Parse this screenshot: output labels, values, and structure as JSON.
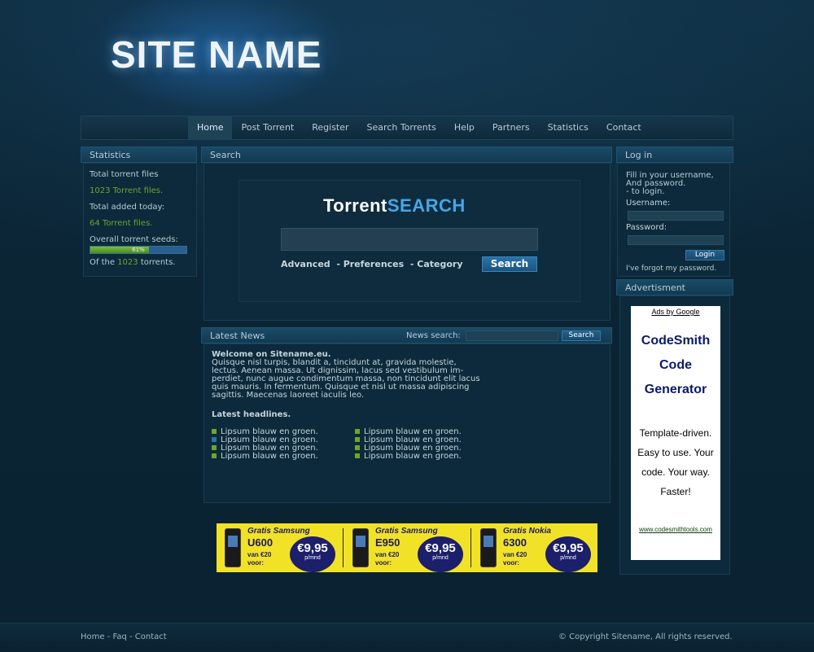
{
  "header": {
    "site_name": "SITE NAME"
  },
  "nav": {
    "items": [
      {
        "label": "Home"
      },
      {
        "label": "Post Torrent"
      },
      {
        "label": "Register"
      },
      {
        "label": "Search Torrents"
      },
      {
        "label": "Help"
      },
      {
        "label": "Partners"
      },
      {
        "label": "Statistics"
      },
      {
        "label": "Contact"
      }
    ],
    "active_index": 0
  },
  "statistics": {
    "title": "Statistics",
    "total_files_label": "Total torrent files",
    "total_files_value": "1023 Torrent files.",
    "added_today_label": "Total added today:",
    "added_today_value": "64 Torrent files.",
    "seeds_label": "Overall torrent seeds:",
    "seeds_percent": 61,
    "seeds_percent_label": "61%",
    "of_prefix": "Of the",
    "of_count": "1023",
    "of_suffix": "torrents."
  },
  "search": {
    "title": "Search",
    "logo_part1": "Torrent",
    "logo_part2": "SEARCH",
    "input_value": "",
    "link_advanced": "Advanced",
    "link_preferences": "- Preferences",
    "link_category": "- Category",
    "button_label": "Search"
  },
  "news": {
    "title": "Latest News",
    "search_label": "News search:",
    "search_value": "",
    "search_button": "Search",
    "welcome_heading": "Welcome on Sitename.eu.",
    "body_lines": [
      "Quisque nisl turpis, blandit a, tincidunt at, gravida molestie,",
      "lectus. Aenean massa. Ut dignissim, lacus sed vestibulum im-",
      "perdiet, nunc augue condimentum massa, non tincidunt elit lacus",
      "quis mauris. In fermentum. Quisque et nisl ut massa adipiscing",
      "sagittis. Maecenas laoreet iaculis leo."
    ],
    "headlines_title": "Latest headlines.",
    "headlines_left": [
      "Lipsum blauw en groen.",
      "Lipsum blauw en groen.",
      "Lipsum blauw en groen.",
      "Lipsum blauw en groen."
    ],
    "headlines_right": [
      "Lipsum blauw en groen.",
      "Lipsum blauw en groen.",
      "Lipsum blauw en groen.",
      "Lipsum blauw en groen."
    ]
  },
  "login": {
    "title": "Log in",
    "intro_lines": [
      "Fill in your username,",
      "And password.",
      "- to login."
    ],
    "username_label": "Username:",
    "username_value": "",
    "password_label": "Password:",
    "password_value": "",
    "button_label": "Login",
    "forgot_link": "I've forgot my password."
  },
  "advertisment": {
    "title": "Advertisment",
    "ads_by": "Ads by Google",
    "ad_title_lines": [
      "CodeSmith",
      "Code",
      "Generator"
    ],
    "ad_body_lines": [
      "Template-driven.",
      "Easy to use.  Your",
      "code.  Your way.",
      "Faster!"
    ],
    "ad_url": "www.codesmithtools.com"
  },
  "banner": {
    "offers": [
      {
        "title": "Gratis Samsung",
        "model": "U600",
        "from_line1": "van €20",
        "from_line2": "voor:",
        "price": "€9,95",
        "per": "p/mnd"
      },
      {
        "title": "Gratis Samsung",
        "model": "E950",
        "from_line1": "van €20",
        "from_line2": "voor:",
        "price": "€9,95",
        "per": "p/mnd"
      },
      {
        "title": "Gratis Nokia",
        "model": "6300",
        "from_line1": "van €20",
        "from_line2": "voor:",
        "price": "€9,95",
        "per": "p/mnd"
      }
    ]
  },
  "footer": {
    "link_home": "Home",
    "sep1": " - ",
    "link_faq": "Faq",
    "sep2": " - ",
    "link_contact": "Contact",
    "copyright": "© Copyright Sitename, All rights reserved."
  },
  "colors": {
    "background": "#0b2535",
    "accent_blue": "#46a6e8",
    "accent_green": "#6fa52d",
    "bullet_green": "#6fa52d",
    "bullet_blue": "#2f6fa8",
    "banner_yellow": "#f2e227"
  }
}
